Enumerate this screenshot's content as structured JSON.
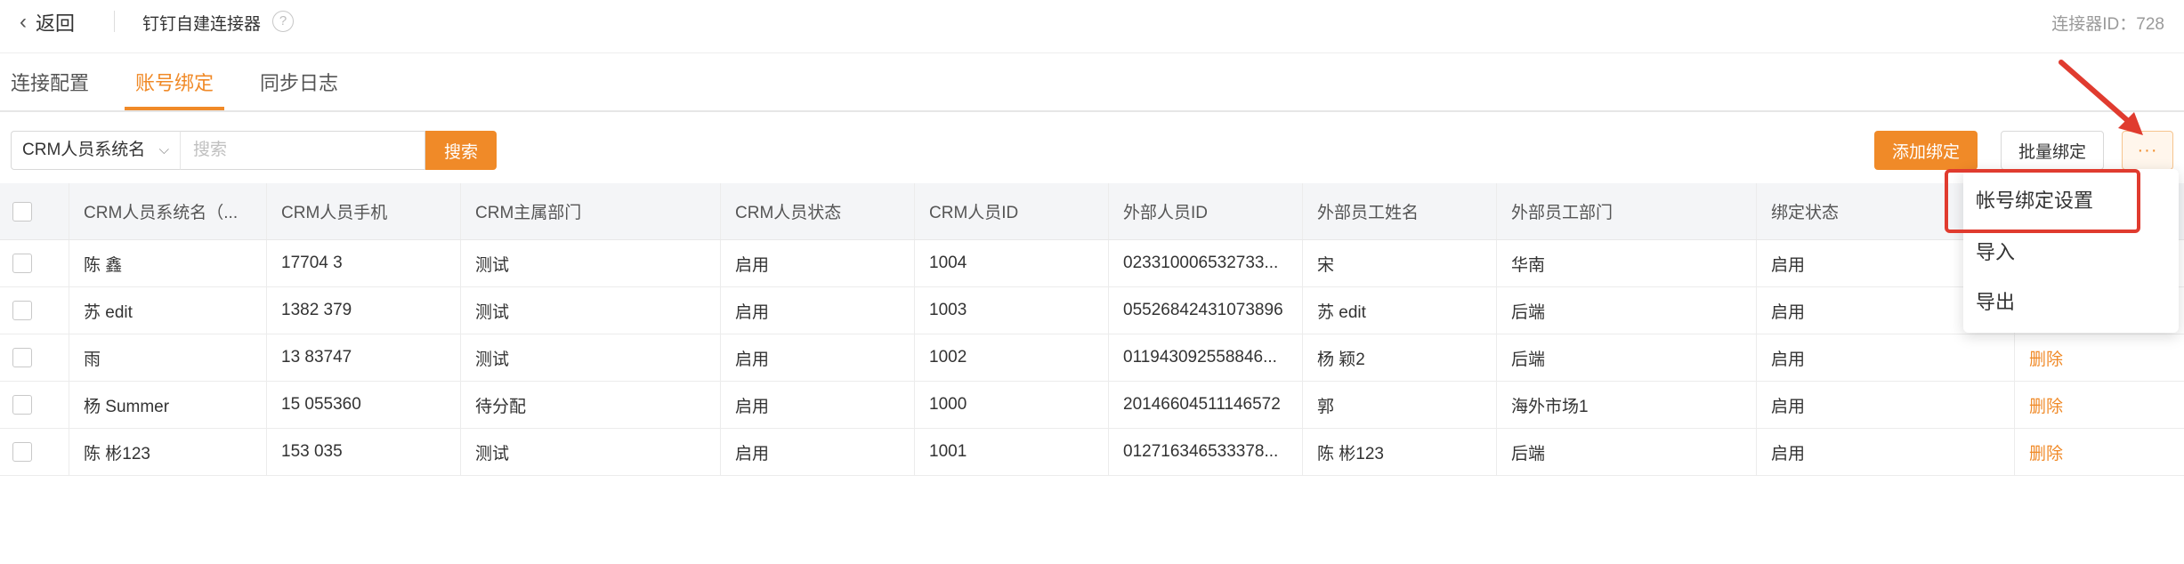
{
  "header": {
    "back_label": "返回",
    "connector_title": "钉钉自建连接器",
    "connector_id_label": "连接器ID：",
    "connector_id_value": "728"
  },
  "tabs": [
    {
      "label": "连接配置",
      "active": false
    },
    {
      "label": "账号绑定",
      "active": true
    },
    {
      "label": "同步日志",
      "active": false
    }
  ],
  "toolbar": {
    "select_value": "CRM人员系统名",
    "search_placeholder": "搜索",
    "search_button": "搜索",
    "add_button": "添加绑定",
    "batch_button": "批量绑定",
    "more_button": "···"
  },
  "table": {
    "columns": [
      "CRM人员系统名（...",
      "CRM人员手机",
      "CRM主属部门",
      "CRM人员状态",
      "CRM人员ID",
      "外部人员ID",
      "外部员工姓名",
      "外部员工部门",
      "绑定状态"
    ],
    "rows": [
      {
        "name": "陈  鑫",
        "phone": "17704      3",
        "dept": "测试",
        "status": "启用",
        "crm_id": "1004",
        "ext_id": "023310006532733...",
        "ext_name": "宋  ",
        "ext_dept": "华南",
        "bind": "启用",
        "op": ""
      },
      {
        "name": "苏  edit",
        "phone": "1382    379",
        "dept": "测试",
        "status": "启用",
        "crm_id": "1003",
        "ext_id": "05526842431073896",
        "ext_name": "苏  edit",
        "ext_dept": "后端",
        "bind": "启用",
        "op": ""
      },
      {
        "name": "  雨",
        "phone": "13   83747",
        "dept": "测试",
        "status": "启用",
        "crm_id": "1002",
        "ext_id": "011943092558846...",
        "ext_name": "杨  颖2",
        "ext_dept": "后端",
        "bind": "启用",
        "op": "删除"
      },
      {
        "name": "杨  Summer",
        "phone": "15   055360",
        "dept": "待分配",
        "status": "启用",
        "crm_id": "1000",
        "ext_id": "20146604511146572",
        "ext_name": "郭  ",
        "ext_dept": "海外市场1",
        "bind": "启用",
        "op": "删除"
      },
      {
        "name": "陈  彬123",
        "phone": "153    035",
        "dept": "测试",
        "status": "启用",
        "crm_id": "1001",
        "ext_id": "012716346533378...",
        "ext_name": "陈  彬123",
        "ext_dept": "后端",
        "bind": "启用",
        "op": "删除"
      }
    ]
  },
  "dropdown": {
    "items": [
      "帐号绑定设置",
      "导入",
      "导出"
    ]
  },
  "colors": {
    "accent": "#f08a28",
    "highlight_red": "#e03b2f"
  }
}
